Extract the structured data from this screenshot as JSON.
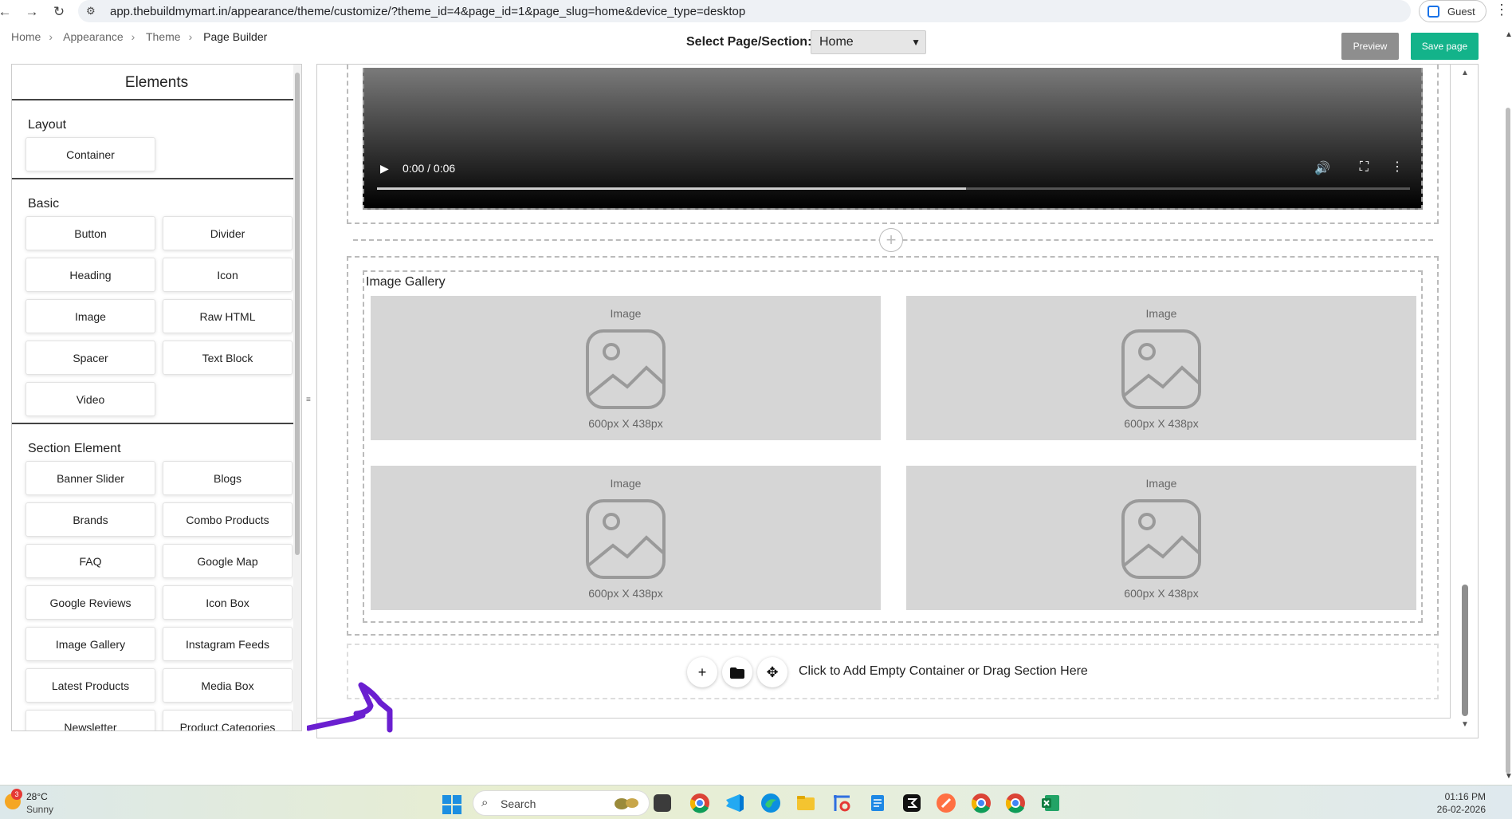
{
  "browser": {
    "url": "app.thebuildmymart.in/appearance/theme/customize/?theme_id=4&page_id=1&page_slug=home&device_type=desktop",
    "profile_label": "Guest"
  },
  "breadcrumb": [
    "Home",
    "Appearance",
    "Theme",
    "Page Builder"
  ],
  "header": {
    "select_label": "Select Page/Section:",
    "selected_page": "Home",
    "preview_label": "Preview",
    "save_label": "Save page"
  },
  "sidebar": {
    "title": "Elements",
    "groups": [
      {
        "title": "Layout",
        "items": [
          "Container"
        ]
      },
      {
        "title": "Basic",
        "items": [
          "Button",
          "Divider",
          "Heading",
          "Icon",
          "Image",
          "Raw HTML",
          "Spacer",
          "Text Block",
          "Video"
        ]
      },
      {
        "title": "Section Element",
        "items": [
          "Banner Slider",
          "Blogs",
          "Brands",
          "Combo Products",
          "FAQ",
          "Google Map",
          "Google Reviews",
          "Icon Box",
          "Image Gallery",
          "Instagram Feeds",
          "Latest Products",
          "Media Box",
          "Newsletter",
          "Product Categories"
        ]
      }
    ]
  },
  "canvas": {
    "video": {
      "time": "0:00 / 0:06",
      "progress": 0.57
    },
    "gallery": {
      "title": "Image Gallery",
      "tiles": [
        {
          "label": "Image",
          "size": "600px X 438px"
        },
        {
          "label": "Image",
          "size": "600px X 438px"
        },
        {
          "label": "Image",
          "size": "600px X 438px"
        },
        {
          "label": "Image",
          "size": "600px X 438px"
        }
      ]
    },
    "add_section_text": "Click to Add Empty Container or Drag Section Here"
  },
  "taskbar": {
    "weather_temp": "28°C",
    "weather_desc": "Sunny",
    "weather_badge": "3",
    "search_label": "Search",
    "time": "01:16 PM",
    "date": "26-02-2026"
  },
  "colors": {
    "save_button": "#13b38a",
    "preview_button": "#8e8e8e",
    "image_placeholder": "#d6d6d6",
    "annotation_scribble": "#6a1fd0"
  }
}
